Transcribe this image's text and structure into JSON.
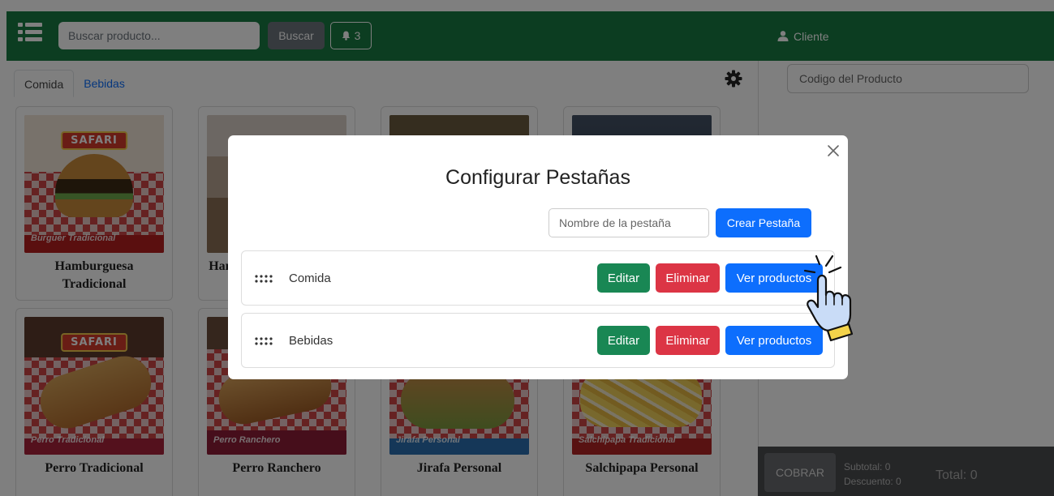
{
  "topbar": {
    "search_placeholder": "Buscar producto...",
    "search_button": "Buscar",
    "notifications_count": "3"
  },
  "client": {
    "label": "Cliente"
  },
  "tabs": [
    {
      "label": "Comida",
      "active": true
    },
    {
      "label": "Bebidas",
      "active": false
    }
  ],
  "products": [
    {
      "name": "Hamburguesa Tradicional",
      "badge": "SAFARI",
      "caption": "Burguer Tradicional"
    },
    {
      "name": "Hamburguesa Ranchera",
      "badge": "",
      "caption": ""
    },
    {
      "name": "",
      "badge": "",
      "caption": ""
    },
    {
      "name": "",
      "badge": "",
      "caption": ""
    },
    {
      "name": "Perro Tradicional",
      "badge": "SAFARI",
      "caption": "Perro Tradicional"
    },
    {
      "name": "Perro Ranchero",
      "badge": "",
      "caption": "Perro Ranchero"
    },
    {
      "name": "Jirafa Personal",
      "badge": "",
      "caption": "Jirafa Personal"
    },
    {
      "name": "Salchipapa Personal",
      "badge": "",
      "caption": "Salchipapa Tradicional"
    }
  ],
  "right_panel": {
    "code_placeholder": "Codigo del Producto",
    "cobrar_button": "COBRAR",
    "subtotal": "Subtotal: 0",
    "descuento": "Descuento: 0",
    "total": "Total: 0"
  },
  "modal": {
    "title": "Configurar Pestañas",
    "tab_name_placeholder": "Nombre de la pestaña",
    "create_button": "Crear Pestaña",
    "rows": [
      {
        "label": "Comida",
        "edit": "Editar",
        "delete": "Eliminar",
        "view": "Ver productos"
      },
      {
        "label": "Bebidas",
        "edit": "Editar",
        "delete": "Eliminar",
        "view": "Ver productos"
      }
    ]
  },
  "colors": {
    "topbar": "#197a43",
    "primary": "#0d6efd",
    "success": "#198754",
    "danger": "#dc3545"
  }
}
